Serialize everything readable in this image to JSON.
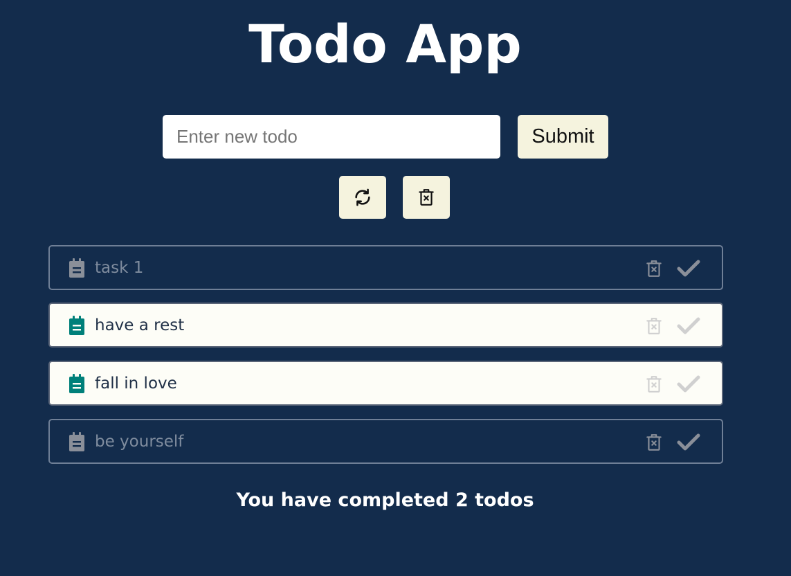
{
  "app": {
    "title": "Todo App"
  },
  "form": {
    "input_placeholder": "Enter new todo",
    "input_value": "",
    "submit_label": "Submit"
  },
  "actions": {
    "refresh_icon": "refresh-icon",
    "clear_icon": "trash-x-icon"
  },
  "todos": [
    {
      "text": "task 1",
      "completed": true
    },
    {
      "text": "have a rest",
      "completed": false
    },
    {
      "text": "fall in love",
      "completed": false
    },
    {
      "text": "be yourself",
      "completed": true
    }
  ],
  "summary": {
    "text": "You have completed 2 todos"
  },
  "colors": {
    "background": "#132c4c",
    "button_bg": "#f5f3de",
    "active_item_bg": "#fdfdf7",
    "active_icon": "#00807a",
    "completed_icon": "#8a8f99"
  }
}
